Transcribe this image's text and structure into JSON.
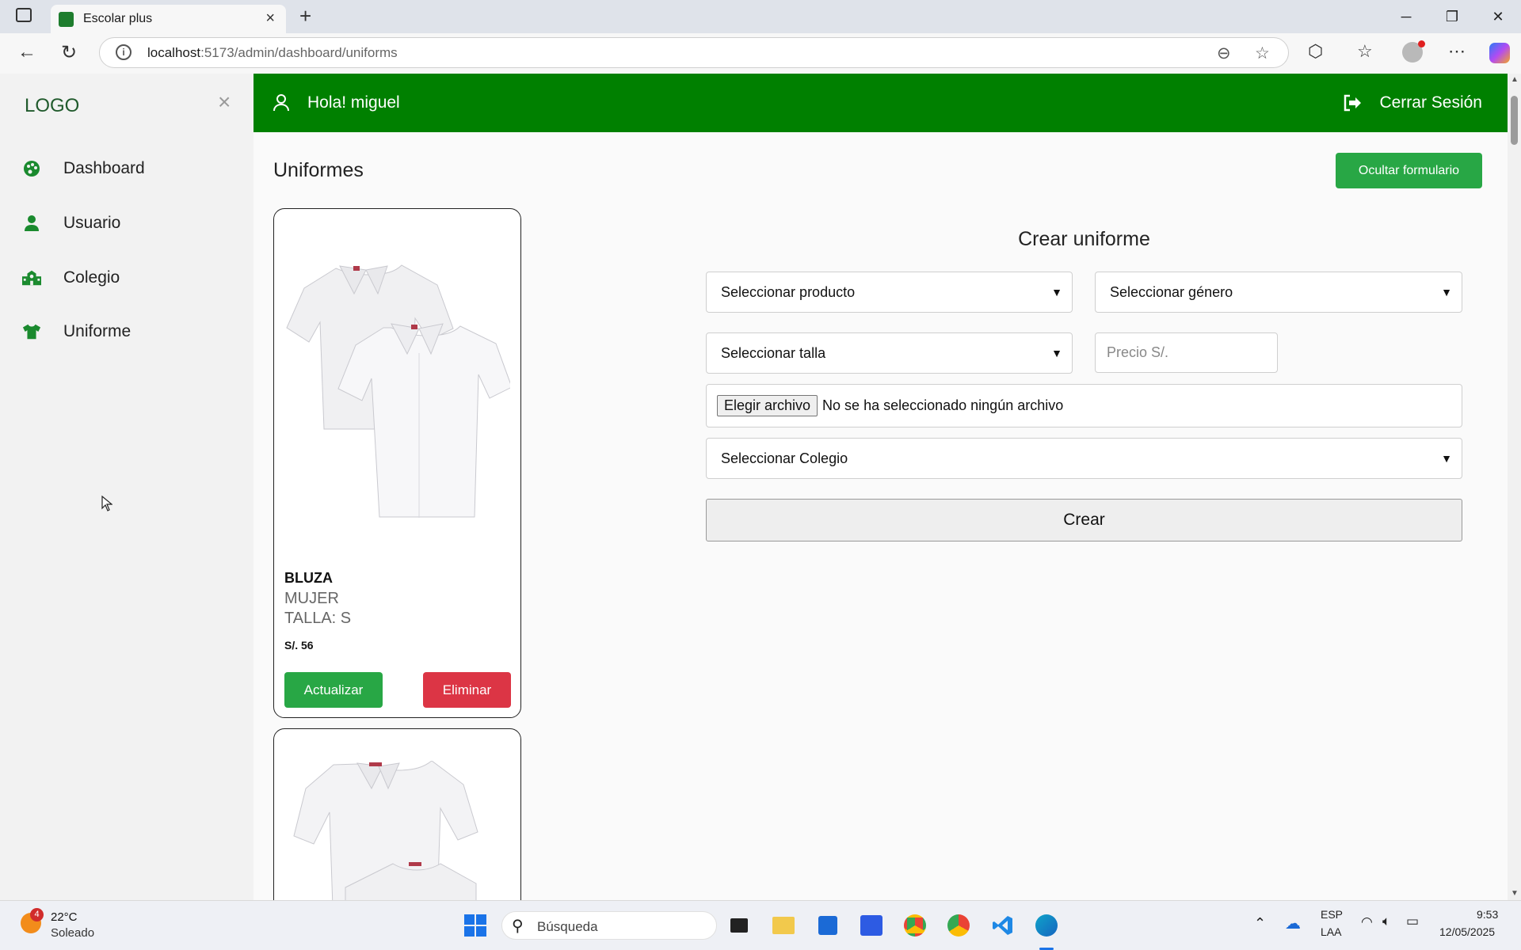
{
  "browser": {
    "tab_title": "Escolar plus",
    "url_host": "localhost",
    "url_rest": ":5173/admin/dashboard/uniforms"
  },
  "sidebar": {
    "logo": "LOGO",
    "items": [
      {
        "label": "Dashboard",
        "icon": "palette-icon"
      },
      {
        "label": "Usuario",
        "icon": "user-icon"
      },
      {
        "label": "Colegio",
        "icon": "school-icon"
      },
      {
        "label": "Uniforme",
        "icon": "shirt-icon"
      }
    ]
  },
  "header": {
    "greeting": "Hola! miguel",
    "logout": "Cerrar Sesión"
  },
  "main": {
    "title": "Uniformes",
    "hide_form_button": "Ocultar formulario",
    "cards": [
      {
        "name": "BLUZA",
        "gender": "MUJER",
        "size": "TALLA: S",
        "price": "S/. 56",
        "update": "Actualizar",
        "delete": "Eliminar"
      }
    ]
  },
  "form": {
    "title": "Crear uniforme",
    "product_select": "Seleccionar producto",
    "gender_select": "Seleccionar género",
    "size_select": "Seleccionar talla",
    "price_placeholder": "Precio S/.",
    "file_button": "Elegir archivo",
    "file_status": "No se ha seleccionado ningún archivo",
    "school_select": "Seleccionar Colegio",
    "submit": "Crear"
  },
  "taskbar": {
    "weather_temp": "22°C",
    "weather_desc": "Soleado",
    "weather_badge": "4",
    "search_placeholder": "Búsqueda",
    "lang_top": "ESP",
    "lang_bottom": "LAA",
    "time": "9:53",
    "date": "12/05/2025"
  },
  "colors": {
    "primary_green": "#008000",
    "button_green": "#28a745",
    "danger_red": "#dc3545"
  }
}
